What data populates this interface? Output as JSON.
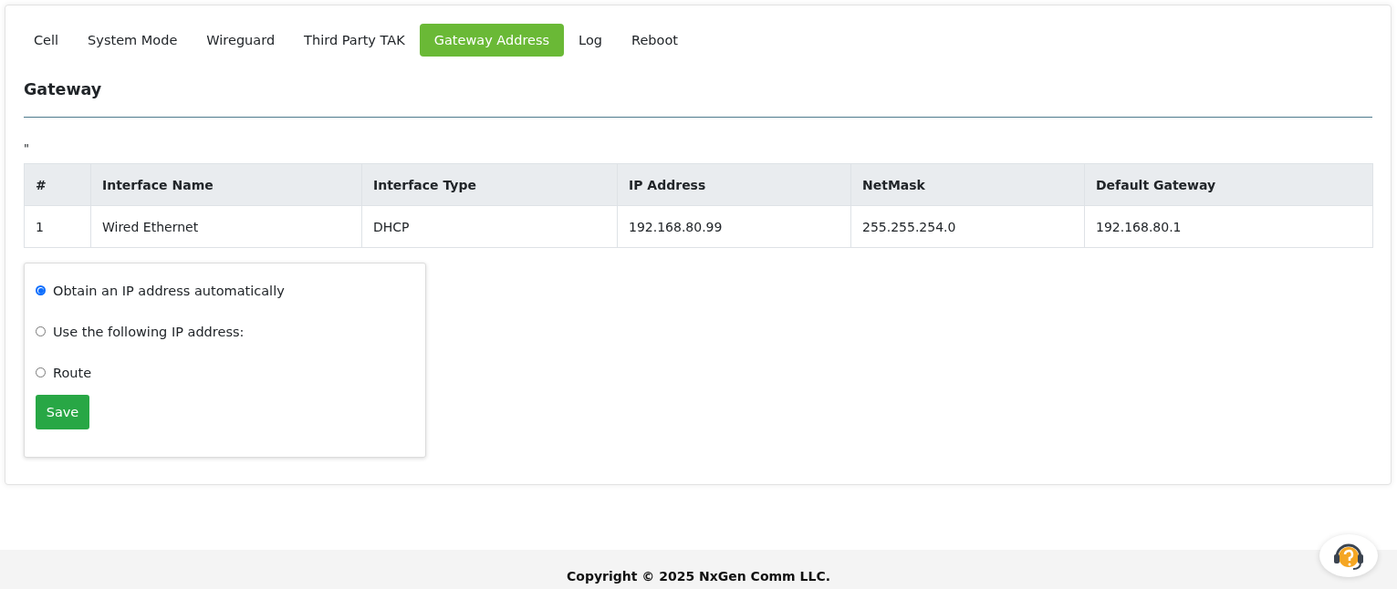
{
  "tabs": [
    {
      "label": "Cell",
      "selected": false
    },
    {
      "label": "System Mode",
      "selected": false
    },
    {
      "label": "Wireguard",
      "selected": false
    },
    {
      "label": "Third Party TAK",
      "selected": false
    },
    {
      "label": "Gateway Address",
      "selected": true
    },
    {
      "label": "Log",
      "selected": false
    },
    {
      "label": "Reboot",
      "selected": false
    }
  ],
  "heading": "Gateway",
  "stray_text": "\"",
  "table": {
    "columns": [
      "#",
      "Interface Name",
      "Interface Type",
      "IP Address",
      "NetMask",
      "Default Gateway"
    ],
    "rows": [
      [
        "1",
        "Wired Ethernet",
        "DHCP",
        "192.168.80.99",
        "255.255.254.0",
        "192.168.80.1"
      ]
    ]
  },
  "options": [
    {
      "label": "Obtain an IP address automatically",
      "selected": true
    },
    {
      "label": "Use the following IP address:",
      "selected": false
    },
    {
      "label": "Route",
      "selected": false
    }
  ],
  "save_button": "Save",
  "footer": "Copyright © 2025 NxGen Comm LLC."
}
